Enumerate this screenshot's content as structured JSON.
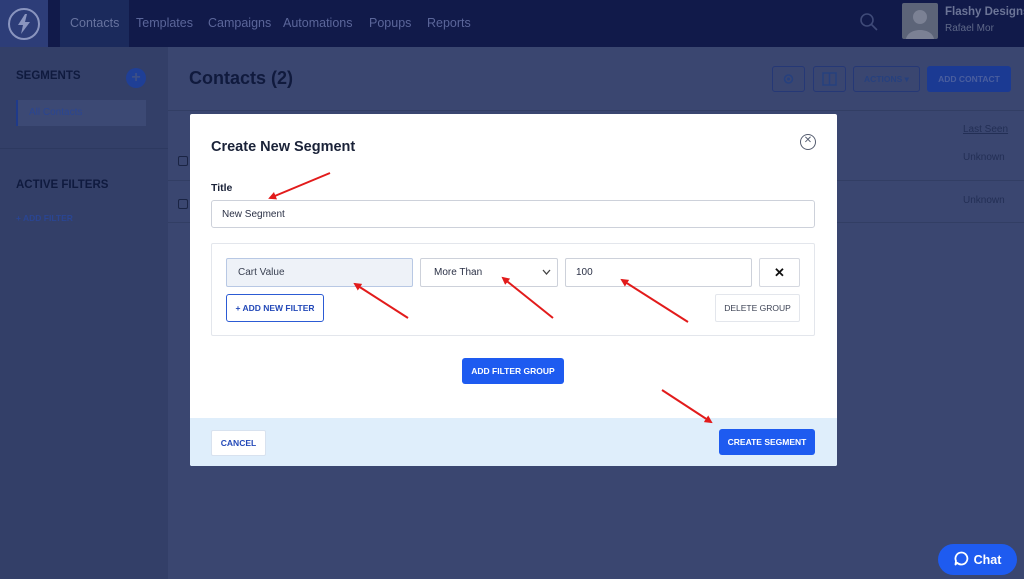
{
  "nav": {
    "items": [
      "Contacts",
      "Templates",
      "Campaigns",
      "Automations",
      "Popups",
      "Reports"
    ],
    "brand": "Flashy Designs",
    "user": "Rafael Mor"
  },
  "sidebar": {
    "segments_heading": "SEGMENTS",
    "all_contacts": "All Contacts",
    "active_filters_heading": "ACTIVE FILTERS",
    "add_filter": "+ ADD FILTER"
  },
  "main": {
    "title": "Contacts (2)",
    "actions_label": "ACTIONS ▾",
    "add_contact_label": "ADD CONTACT",
    "last_seen_header": "Last Seen",
    "rows": [
      {
        "last_seen": "Unknown"
      },
      {
        "last_seen": "Unknown"
      }
    ]
  },
  "modal": {
    "title": "Create New Segment",
    "title_label": "Title",
    "title_value": "New Segment",
    "filter": {
      "field": "Cart Value",
      "operator": "More Than",
      "value": "100"
    },
    "add_new_filter": "+ ADD NEW FILTER",
    "delete_group": "DELETE GROUP",
    "add_filter_group": "ADD FILTER GROUP",
    "cancel": "CANCEL",
    "create_segment": "CREATE SEGMENT"
  },
  "chat": {
    "label": "Chat"
  },
  "colors": {
    "accent": "#1e5bf0",
    "annotation_arrow": "#e21b1b"
  }
}
